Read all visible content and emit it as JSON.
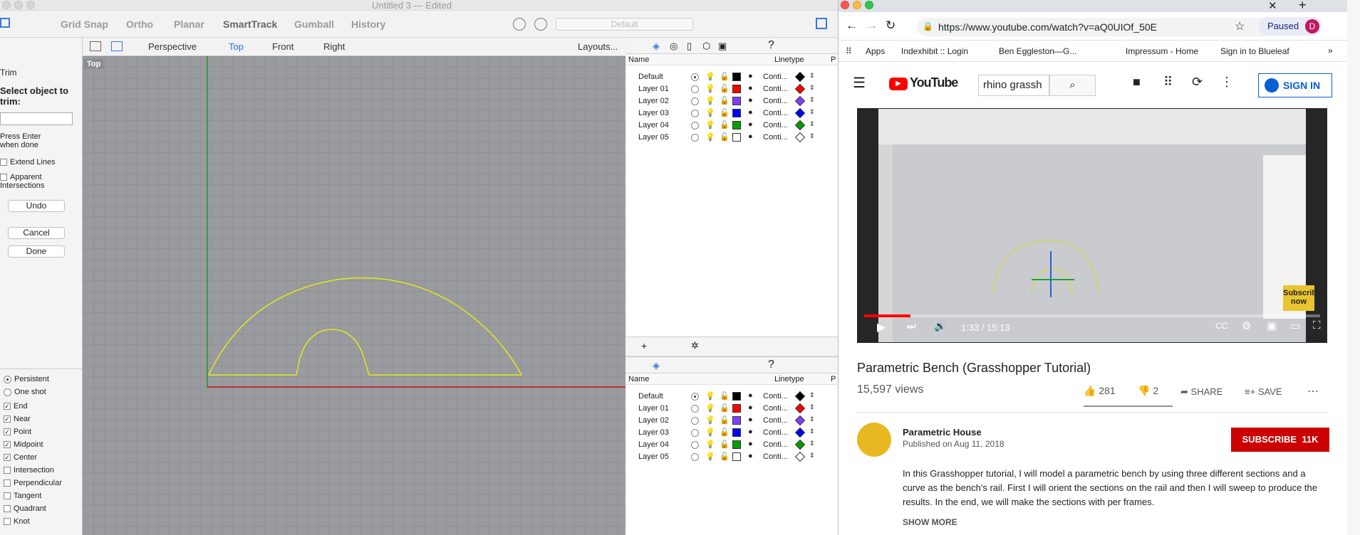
{
  "rhino": {
    "title": "Untitled 3 — Edited",
    "toolbar": [
      "Grid Snap",
      "Ortho",
      "Planar",
      "SmartTrack",
      "Gumball",
      "History"
    ],
    "history_field": "Default",
    "command": {
      "name": "Trim",
      "prompt": "Select object to trim:",
      "hint": "Press Enter when done",
      "options": [
        "Extend Lines",
        "Apparent Intersections"
      ],
      "undo": "Undo",
      "cancel": "Cancel",
      "done": "Done",
      "snap_mode": [
        "Persistent",
        "One shot"
      ],
      "osnaps": [
        {
          "label": "End",
          "checked": true
        },
        {
          "label": "Near",
          "checked": true
        },
        {
          "label": "Point",
          "checked": true
        },
        {
          "label": "Midpoint",
          "checked": true
        },
        {
          "label": "Center",
          "checked": true
        },
        {
          "label": "Intersection",
          "checked": false
        },
        {
          "label": "Perpendicular",
          "checked": false
        },
        {
          "label": "Tangent",
          "checked": false
        },
        {
          "label": "Quadrant",
          "checked": false
        },
        {
          "label": "Knot",
          "checked": false
        }
      ]
    },
    "view_tabs": [
      "Perspective",
      "Top",
      "Front",
      "Right"
    ],
    "layouts": "Layouts...",
    "viewport_label": "Top",
    "layer_headers": {
      "name": "Name",
      "linetype": "Linetype",
      "print": "P"
    },
    "layers": [
      {
        "name": "Default",
        "color": "#000000",
        "linetype": "Conti..."
      },
      {
        "name": "Layer 01",
        "color": "#ff0000",
        "linetype": "Conti..."
      },
      {
        "name": "Layer 02",
        "color": "#8040ff",
        "linetype": "Conti..."
      },
      {
        "name": "Layer 03",
        "color": "#0000ff",
        "linetype": "Conti..."
      },
      {
        "name": "Layer 04",
        "color": "#00a000",
        "linetype": "Conti..."
      },
      {
        "name": "Layer 05",
        "color": "#ffffff",
        "linetype": "Conti..."
      }
    ]
  },
  "browser": {
    "url": "https://www.youtube.com/watch?v=aQ0UIOf_50E",
    "paused": "Paused",
    "profile": "D",
    "bookmarks": [
      "Apps",
      "Indexhibit :: Login",
      "Ben Eggleston—G...",
      "Impressum - Home",
      "Sign in to Blueleaf"
    ],
    "search": "rhino grassh",
    "sign_in": "SIGN IN",
    "logo": "YouTube",
    "player": {
      "time": "1:33 / 15:13",
      "subscribe_badge": "Subscribe now",
      "progress": 0.102
    },
    "video_title": "Parametric Bench (Grasshopper Tutorial)",
    "views": "15,597 views",
    "likes": "281",
    "dislikes": "2",
    "share": "SHARE",
    "save": "SAVE",
    "channel": "Parametric House",
    "published": "Published on Aug 11, 2018",
    "subscribe": "SUBSCRIBE",
    "subs": "11K",
    "description": "In this Grasshopper tutorial, I will model a parametric bench by using three different sections and a curve as the bench's rail. First I will orient the sections on the rail and then I will sweep to produce the results. In the end, we will make the sections with per frames.",
    "show_more": "SHOW MORE"
  }
}
